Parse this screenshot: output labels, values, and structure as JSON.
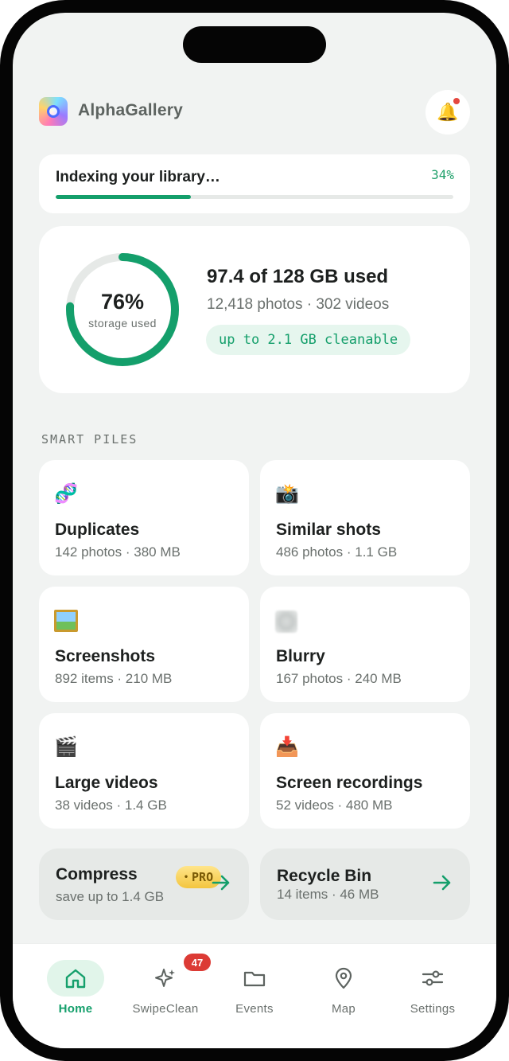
{
  "app": {
    "title": "AlphaGallery",
    "logo_icon": "gallery-logo-icon",
    "notification_icon": "bell-icon"
  },
  "indexing": {
    "title": "Indexing your library…",
    "percent_text": "34%",
    "progress": 0.34
  },
  "storage": {
    "percent_text": "76%",
    "percent_caption": "storage used",
    "ring_fraction": 0.76,
    "used_text": "97.4 of 128 GB used",
    "counts_text": "12,418 photos · 302 videos",
    "cleanable_text": "up to 2.1 GB cleanable"
  },
  "section_label": "SMART PILES",
  "piles": [
    {
      "icon": "dna-icon",
      "emoji": "🧬",
      "name": "Duplicates",
      "meta": "142 photos · 380 MB"
    },
    {
      "icon": "camera-flash-icon",
      "emoji": "📸",
      "name": "Similar shots",
      "meta": "486 photos · 1.1 GB"
    },
    {
      "icon": "framed-picture-icon",
      "emoji": "",
      "name": "Screenshots",
      "meta": "892 items · 210 MB"
    },
    {
      "icon": "blur-icon",
      "emoji": "",
      "name": "Blurry",
      "meta": "167 photos · 240 MB"
    },
    {
      "icon": "clapper-board-icon",
      "emoji": "🎬",
      "name": "Large videos",
      "meta": "38 videos · 1.4 GB"
    },
    {
      "icon": "inbox-tray-icon",
      "emoji": "📥",
      "name": "Screen recordings",
      "meta": "52 videos · 480 MB"
    }
  ],
  "actions": {
    "compress": {
      "title": "Compress",
      "badge": "PRO",
      "subtitle": "save up to 1.4 GB"
    },
    "recycle": {
      "title": "Recycle Bin",
      "subtitle": "14 items · 46 MB"
    }
  },
  "tabs": [
    {
      "label": "Home",
      "icon": "home-icon",
      "active": true
    },
    {
      "label": "SwipeClean",
      "icon": "sparkle-icon",
      "badge": "47"
    },
    {
      "label": "Events",
      "icon": "folder-icon"
    },
    {
      "label": "Map",
      "icon": "map-pin-icon"
    },
    {
      "label": "Settings",
      "icon": "sliders-icon"
    }
  ],
  "colors": {
    "accent": "#149f6b",
    "accent_soft": "#e6f6ee",
    "badge_red": "#dc3b35",
    "background": "#f1f3f2"
  }
}
